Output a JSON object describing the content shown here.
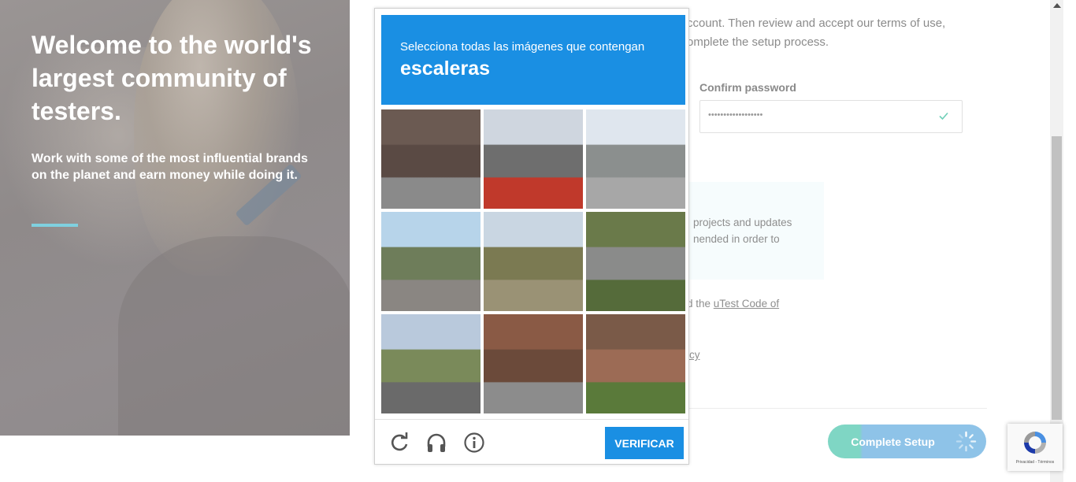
{
  "hero": {
    "title": "Welcome to the world's largest community of testers.",
    "subtitle": "Work with some of the most influential brands on the planet and earn money while doing it."
  },
  "form": {
    "intro": "ccount. Then review and accept our terms of use, omplete the setup process.",
    "confirm_label": "Confirm password",
    "confirm_value": "••••••••••••••••••",
    "info_text": "projects and updates nended in order to",
    "code_prefix": "d the ",
    "code_link": "uTest Code of",
    "policy_text": "icy",
    "complete_button": "Complete Setup"
  },
  "captcha": {
    "prompt": "Selecciona todas las imágenes que contengan",
    "target": "escaleras",
    "verify_button": "VERIFICAR",
    "tiles": [
      {
        "name": "tile-1",
        "colors": [
          "#6b5a52",
          "#5a4a44",
          "#8a8a8a"
        ]
      },
      {
        "name": "tile-2",
        "colors": [
          "#cfd6df",
          "#6e6e6e",
          "#c0392b"
        ]
      },
      {
        "name": "tile-3",
        "colors": [
          "#dfe6ee",
          "#8b8f8e",
          "#a7a7a7"
        ]
      },
      {
        "name": "tile-4",
        "colors": [
          "#b7d4ea",
          "#6e7d5a",
          "#8a8682"
        ]
      },
      {
        "name": "tile-5",
        "colors": [
          "#c9d6e2",
          "#7b7a52",
          "#9a9275"
        ]
      },
      {
        "name": "tile-6",
        "colors": [
          "#6a7a4a",
          "#8a8b8a",
          "#556b3a"
        ]
      },
      {
        "name": "tile-7",
        "colors": [
          "#b9c9dc",
          "#7a8a5a",
          "#6a6a6a"
        ]
      },
      {
        "name": "tile-8",
        "colors": [
          "#8a5a45",
          "#6b4a3a",
          "#8c8c8c"
        ]
      },
      {
        "name": "tile-9",
        "colors": [
          "#7a5a48",
          "#9c6b55",
          "#5a7a3a"
        ]
      }
    ]
  },
  "recaptcha": {
    "links": "Privacidad - Términos"
  },
  "colors": {
    "captcha_blue": "#1a8fe3",
    "hero_accent": "#7fd0df",
    "button_green": "#7fd6c4",
    "button_blue": "#8ec3e8"
  }
}
